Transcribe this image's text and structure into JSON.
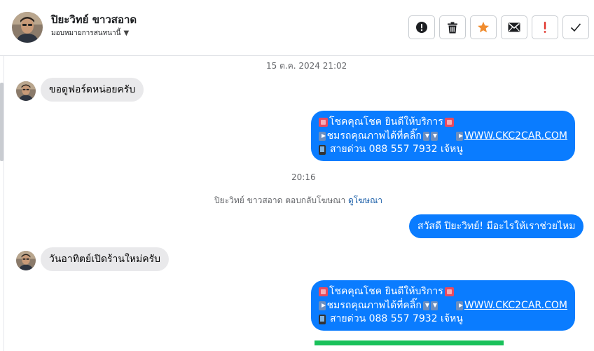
{
  "header": {
    "contact_name": "ปิยะวิทย์ ขาวสอาด",
    "assign_label": "มอบหมายการสนทนานี้",
    "actions": [
      {
        "name": "spam",
        "icon": "exclamation-circle-icon"
      },
      {
        "name": "delete",
        "icon": "trash-icon"
      },
      {
        "name": "star",
        "icon": "star-icon",
        "color": "#f08c2e"
      },
      {
        "name": "mark-unread",
        "icon": "envelope-icon"
      },
      {
        "name": "follow-up",
        "icon": "exclamation-icon",
        "color": "#e0332a"
      },
      {
        "name": "done",
        "icon": "check-icon"
      }
    ]
  },
  "conversation": {
    "timestamp_1": "15 ต.ค. 2024 21:02",
    "msg_in_1": "ขอดูฟอร์ดหน่อยครับ",
    "promo": {
      "line1": "โชคคุณโชค ยินดีให้บริการ",
      "line2_text": "ชมรถคุณภาพได้ที่คลิ๊ก",
      "line2_url": "WWW.CKC2CAR.COM",
      "line3": "สายด่วน 088 557 7932 เจ้หนู"
    },
    "timestamp_2": "20:16",
    "system_note": "ปิยะวิทย์ ขาวสอาด ตอบกลับโฆษณา",
    "system_note_link": "ดูโฆษณา",
    "msg_out_greet": "สวัสดี ปิยะวิทย์! มีอะไรให้เราช่วยไหม",
    "msg_in_2": "วันอาทิตย์เปิดร้านใหม่ครับ"
  },
  "upload_progress": 1.0,
  "colors": {
    "bubble_out": "#0a7cff",
    "bubble_in": "#e9e9eb",
    "progress": "#19c15a",
    "link": "#1a5ea8"
  }
}
